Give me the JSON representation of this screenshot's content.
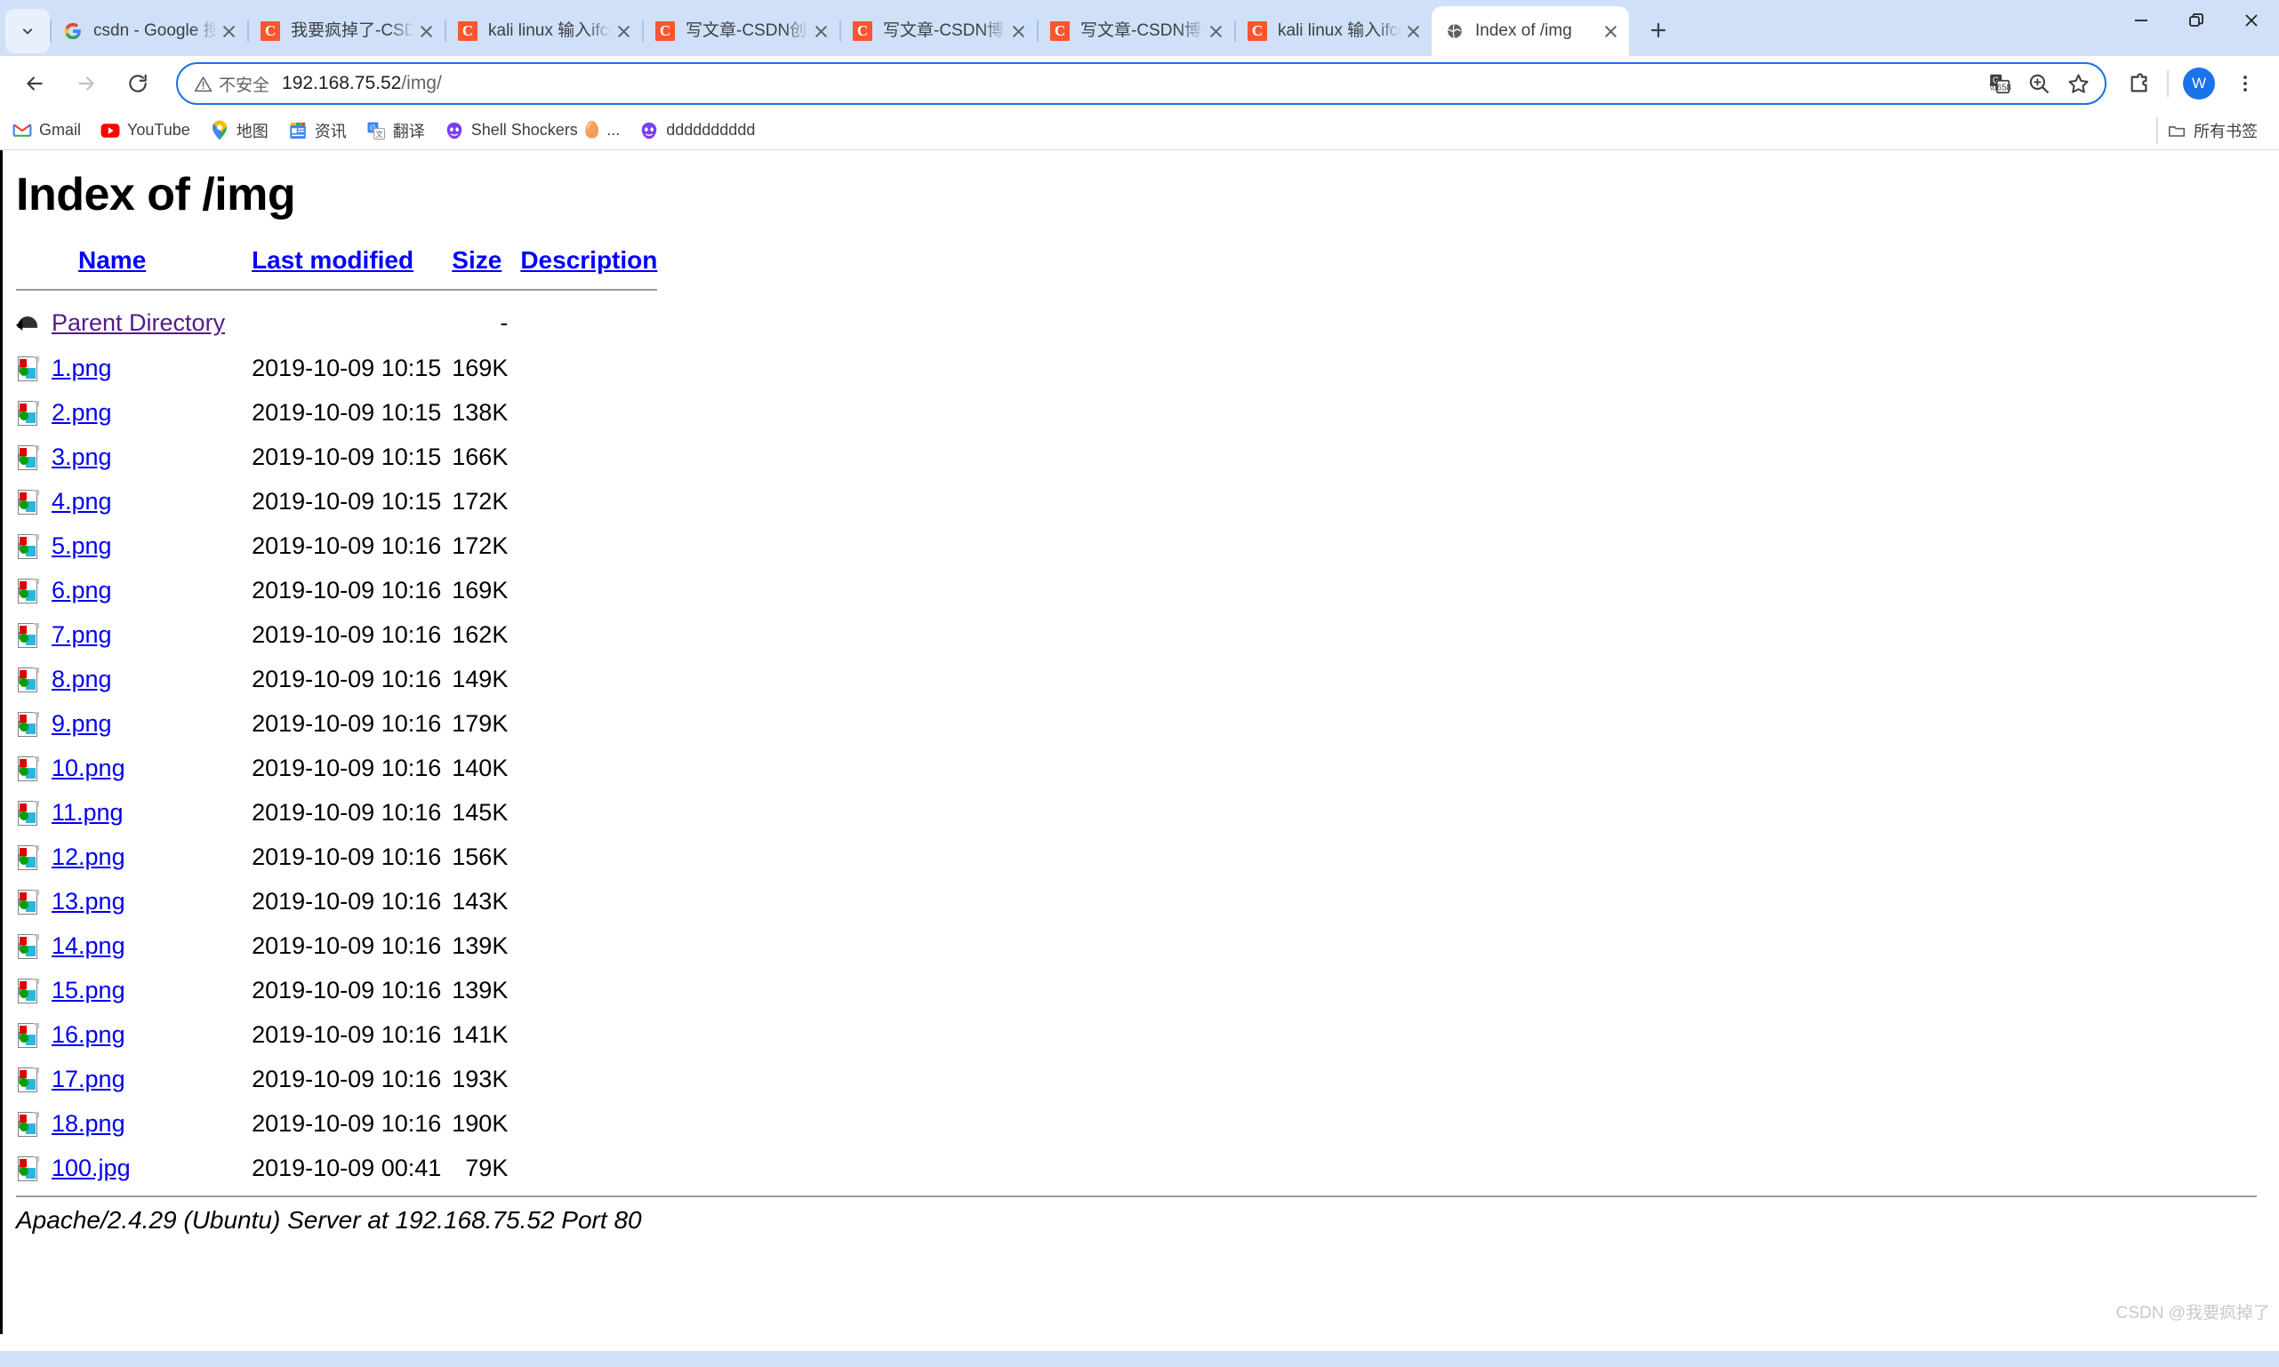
{
  "window": {
    "controls": {
      "minimize": "—",
      "maximize": "❐",
      "close": "✕"
    },
    "tab_search_icon": "chevron-down-icon",
    "new_tab_label": "+"
  },
  "tabs": [
    {
      "title": "csdn - Google 搜索",
      "favicon": "google-icon",
      "active": false,
      "close": "✕"
    },
    {
      "title": "我要疯掉了-CSDN博",
      "favicon": "csdn-icon",
      "active": false,
      "close": "✕"
    },
    {
      "title": "kali linux 输入ifconf",
      "favicon": "csdn-icon",
      "active": false,
      "close": "✕"
    },
    {
      "title": "写文章-CSDN创作中",
      "favicon": "csdn-icon",
      "active": false,
      "close": "✕"
    },
    {
      "title": "写文章-CSDN博客",
      "favicon": "csdn-icon",
      "active": false,
      "close": "✕"
    },
    {
      "title": "写文章-CSDN博客",
      "favicon": "csdn-icon",
      "active": false,
      "close": "✕"
    },
    {
      "title": "kali linux 输入ifconf",
      "favicon": "csdn-icon",
      "active": false,
      "close": "✕"
    },
    {
      "title": "Index of /img",
      "favicon": "globe-icon",
      "active": true,
      "close": "✕"
    }
  ],
  "toolbar": {
    "back_icon": "arrow-left-icon",
    "forward_icon": "arrow-right-icon",
    "reload_icon": "reload-icon",
    "security_label": "不安全",
    "security_icon": "warning-triangle-icon",
    "url": "192.168.75.52/img/",
    "url_host": "192.168.75.52",
    "url_path": "/img/",
    "translate_icon": "translate-icon",
    "zoom_icon": "zoom-in-icon",
    "bookmark_icon": "star-icon",
    "extensions_icon": "puzzle-icon",
    "profile_initial": "W",
    "menu_icon": "three-dots-icon",
    "accent_color": "#1a73e8"
  },
  "bookmarks": {
    "items": [
      {
        "label": "Gmail",
        "icon": "gmail-icon"
      },
      {
        "label": "YouTube",
        "icon": "youtube-icon"
      },
      {
        "label": "地图",
        "icon": "maps-pin-icon"
      },
      {
        "label": "资讯",
        "icon": "google-news-icon"
      },
      {
        "label": "翻译",
        "icon": "google-translate-icon"
      },
      {
        "label": "Shell Shockers 🥚 ...",
        "icon": "shell-shockers-icon"
      },
      {
        "label": "dddddddddd",
        "icon": "shell-shockers-icon"
      }
    ],
    "all_bookmarks_label": "所有书签",
    "all_bookmarks_icon": "folder-icon"
  },
  "page": {
    "heading": "Index of /img",
    "columns": {
      "name": "Name",
      "last_modified": "Last modified",
      "size": "Size",
      "description": "Description"
    },
    "parent": {
      "label": "Parent Directory",
      "modified": "",
      "size": "-",
      "icon": "parent-directory-icon"
    },
    "rows": [
      {
        "name": "1.png",
        "modified": "2019-10-09 10:15",
        "size": "169K",
        "icon": "image-file-icon"
      },
      {
        "name": "2.png",
        "modified": "2019-10-09 10:15",
        "size": "138K",
        "icon": "image-file-icon"
      },
      {
        "name": "3.png",
        "modified": "2019-10-09 10:15",
        "size": "166K",
        "icon": "image-file-icon"
      },
      {
        "name": "4.png",
        "modified": "2019-10-09 10:15",
        "size": "172K",
        "icon": "image-file-icon"
      },
      {
        "name": "5.png",
        "modified": "2019-10-09 10:16",
        "size": "172K",
        "icon": "image-file-icon"
      },
      {
        "name": "6.png",
        "modified": "2019-10-09 10:16",
        "size": "169K",
        "icon": "image-file-icon"
      },
      {
        "name": "7.png",
        "modified": "2019-10-09 10:16",
        "size": "162K",
        "icon": "image-file-icon"
      },
      {
        "name": "8.png",
        "modified": "2019-10-09 10:16",
        "size": "149K",
        "icon": "image-file-icon"
      },
      {
        "name": "9.png",
        "modified": "2019-10-09 10:16",
        "size": "179K",
        "icon": "image-file-icon"
      },
      {
        "name": "10.png",
        "modified": "2019-10-09 10:16",
        "size": "140K",
        "icon": "image-file-icon"
      },
      {
        "name": "11.png",
        "modified": "2019-10-09 10:16",
        "size": "145K",
        "icon": "image-file-icon"
      },
      {
        "name": "12.png",
        "modified": "2019-10-09 10:16",
        "size": "156K",
        "icon": "image-file-icon"
      },
      {
        "name": "13.png",
        "modified": "2019-10-09 10:16",
        "size": "143K",
        "icon": "image-file-icon"
      },
      {
        "name": "14.png",
        "modified": "2019-10-09 10:16",
        "size": "139K",
        "icon": "image-file-icon"
      },
      {
        "name": "15.png",
        "modified": "2019-10-09 10:16",
        "size": "139K",
        "icon": "image-file-icon"
      },
      {
        "name": "16.png",
        "modified": "2019-10-09 10:16",
        "size": "141K",
        "icon": "image-file-icon"
      },
      {
        "name": "17.png",
        "modified": "2019-10-09 10:16",
        "size": "193K",
        "icon": "image-file-icon"
      },
      {
        "name": "18.png",
        "modified": "2019-10-09 10:16",
        "size": "190K",
        "icon": "image-file-icon"
      },
      {
        "name": "100.jpg",
        "modified": "2019-10-09 00:41",
        "size": "79K",
        "icon": "image-file-icon"
      }
    ],
    "server_signature": "Apache/2.4.29 (Ubuntu) Server at 192.168.75.52 Port 80",
    "link_color": "#0000ee",
    "visited_link_color": "#551a8b"
  },
  "watermark": "CSDN @我要疯掉了"
}
